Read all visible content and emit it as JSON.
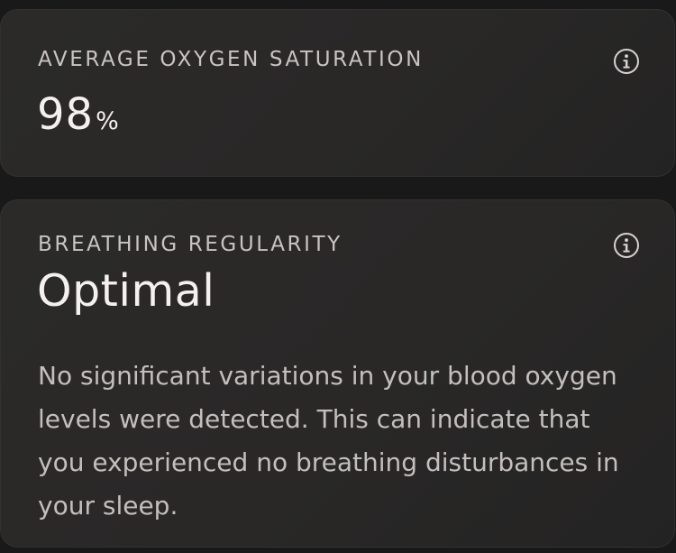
{
  "oxygen_card": {
    "label": "AVERAGE OXYGEN SATURATION",
    "value": "98",
    "unit": "%",
    "info_icon": "info-circle-icon"
  },
  "breathing_card": {
    "label": "BREATHING REGULARITY",
    "status": "Optimal",
    "description": "No significant variations in your blood oxygen levels were detected. This can indicate that you experienced no breathing disturbances in your sleep.",
    "info_icon": "info-circle-icon"
  },
  "colors": {
    "background": "#1a1919",
    "card": "#2a2928",
    "label_text": "#c9c4c2",
    "primary_text": "#f5f0f0",
    "body_text": "#c4bfbd"
  }
}
